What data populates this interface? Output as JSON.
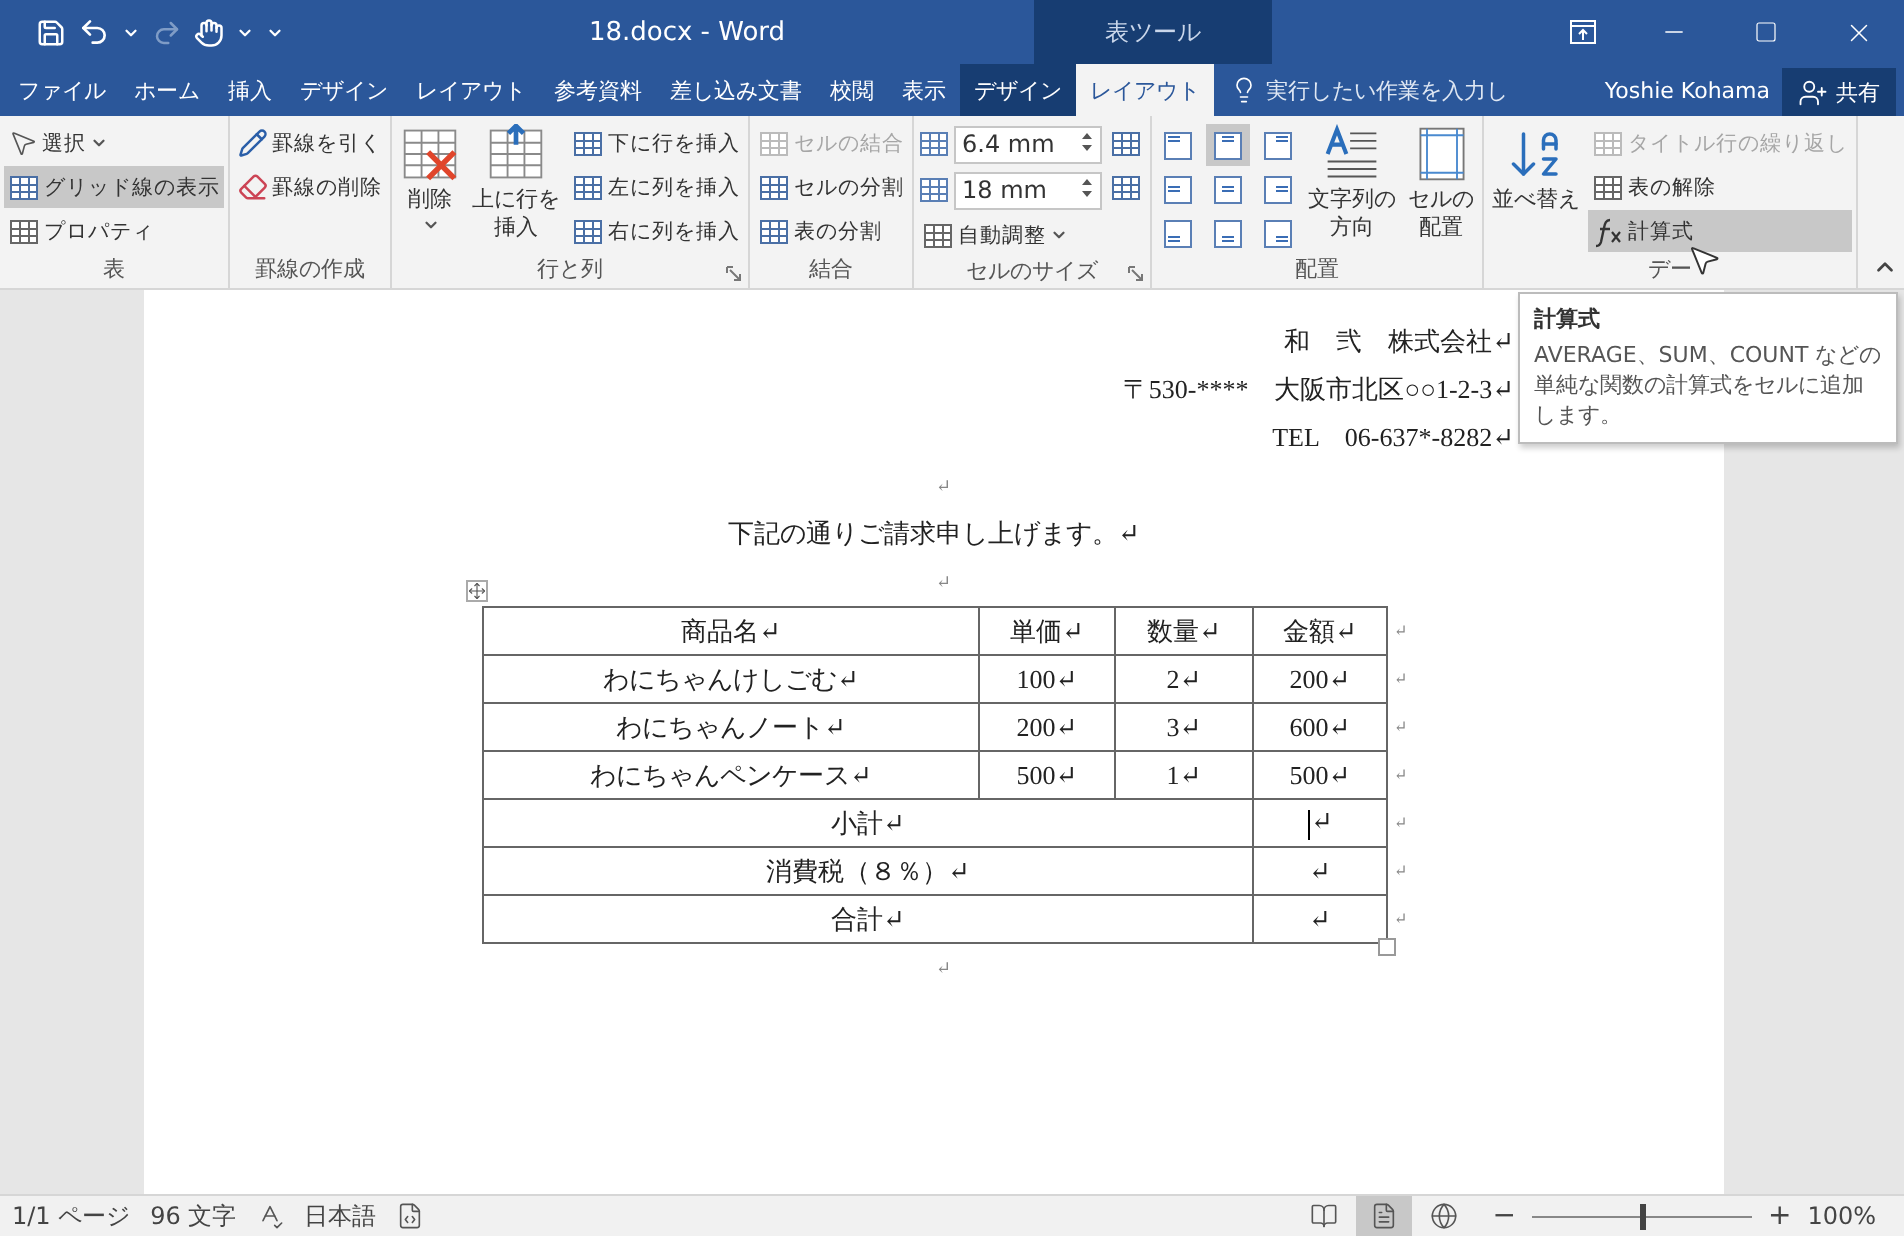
{
  "window": {
    "title": "18.docx - Word",
    "context_label": "表ツール"
  },
  "tabs": [
    {
      "label": "ファイル",
      "selected": false,
      "contextual": false
    },
    {
      "label": "ホーム",
      "selected": false,
      "contextual": false
    },
    {
      "label": "挿入",
      "selected": false,
      "contextual": false
    },
    {
      "label": "デザイン",
      "selected": false,
      "contextual": false
    },
    {
      "label": "レイアウト",
      "selected": false,
      "contextual": false
    },
    {
      "label": "参考資料",
      "selected": false,
      "contextual": false
    },
    {
      "label": "差し込み文書",
      "selected": false,
      "contextual": false
    },
    {
      "label": "校閲",
      "selected": false,
      "contextual": false
    },
    {
      "label": "表示",
      "selected": false,
      "contextual": false
    },
    {
      "label": "デザイン",
      "selected": false,
      "contextual": true
    },
    {
      "label": "レイアウト",
      "selected": true,
      "contextual": true
    }
  ],
  "tell_me": {
    "placeholder": "実行したい作業を入力し"
  },
  "user": "Yoshie Kohama",
  "share": "共有",
  "ribbon": {
    "groups": [
      {
        "label": "表",
        "launcher": false,
        "columns": [
          [
            {
              "kind": "small",
              "label": "選択",
              "dropdown": true,
              "selected": false,
              "disabled": false
            },
            {
              "kind": "small",
              "label": "グリッド線の表示",
              "selected": true,
              "disabled": false
            },
            {
              "kind": "small",
              "label": "プロパティ",
              "selected": false,
              "disabled": false
            }
          ]
        ]
      },
      {
        "label": "罫線の作成",
        "launcher": false,
        "columns": [
          [
            {
              "kind": "small",
              "label": "罫線を引く",
              "selected": false,
              "disabled": false
            },
            {
              "kind": "small",
              "label": "罫線の削除",
              "selected": false,
              "disabled": false
            }
          ]
        ]
      },
      {
        "label": "行と列",
        "launcher": true,
        "columns": [
          [
            {
              "kind": "large",
              "lines": [
                "削除"
              ],
              "dropdown": true,
              "selected": false,
              "disabled": false
            }
          ],
          [
            {
              "kind": "large",
              "lines": [
                "上に行を",
                "挿入"
              ],
              "selected": false,
              "disabled": false
            }
          ],
          [
            {
              "kind": "small",
              "label": "下に行を挿入",
              "selected": false,
              "disabled": false
            },
            {
              "kind": "small",
              "label": "左に列を挿入",
              "selected": false,
              "disabled": false
            },
            {
              "kind": "small",
              "label": "右に列を挿入",
              "selected": false,
              "disabled": false
            }
          ]
        ]
      },
      {
        "label": "結合",
        "launcher": false,
        "columns": [
          [
            {
              "kind": "small",
              "label": "セルの結合",
              "selected": false,
              "disabled": true
            },
            {
              "kind": "small",
              "label": "セルの分割",
              "selected": false,
              "disabled": false
            },
            {
              "kind": "small",
              "label": "表の分割",
              "selected": false,
              "disabled": false
            }
          ]
        ]
      },
      {
        "label": "セルのサイズ",
        "launcher": true,
        "columns": [
          [
            {
              "kind": "spin",
              "value": "6.4 mm"
            },
            {
              "kind": "spin",
              "value": "18 mm"
            },
            {
              "kind": "small",
              "label": "自動調整",
              "dropdown": true,
              "selected": false,
              "disabled": false
            }
          ],
          [
            {
              "kind": "icon",
              "selected": false
            },
            {
              "kind": "icon",
              "selected": false
            }
          ]
        ]
      },
      {
        "label": "配置",
        "launcher": false,
        "columns": [
          [
            {
              "kind": "align",
              "cells": [
                {
                  "selected": false
                },
                {
                  "selected": true
                },
                {
                  "selected": false
                },
                {
                  "selected": false
                },
                {
                  "selected": false
                },
                {
                  "selected": false
                },
                {
                  "selected": false
                },
                {
                  "selected": false
                },
                {
                  "selected": false
                }
              ]
            }
          ],
          [
            {
              "kind": "large",
              "lines": [
                "文字列の",
                "方向"
              ],
              "selected": false,
              "disabled": false
            }
          ],
          [
            {
              "kind": "large",
              "lines": [
                "セルの",
                "配置"
              ],
              "selected": false,
              "disabled": false
            }
          ]
        ]
      },
      {
        "label": "デー",
        "launcher": false,
        "columns": [
          [
            {
              "kind": "large",
              "lines": [
                "並べ替え"
              ],
              "selected": false,
              "disabled": false
            }
          ],
          [
            {
              "kind": "small",
              "label": "タイトル行の繰り返し",
              "selected": false,
              "disabled": true
            },
            {
              "kind": "small",
              "label": "表の解除",
              "selected": false,
              "disabled": false
            },
            {
              "kind": "small",
              "label": "計算式",
              "selected": true,
              "disabled": false
            }
          ]
        ]
      }
    ]
  },
  "document": {
    "header_lines": [
      "和　弐　株式会社↵",
      "〒530-****　大阪市北区○○1-2-3↵",
      "TEL　06-637*-8282↵"
    ],
    "blank_before": "↵",
    "greeting": "下記の通りご請求申し上げます。↵",
    "blank_mid": "↵",
    "table": {
      "columns": [
        "商品名↵",
        "単価↵",
        "数量↵",
        "金額↵"
      ],
      "header_end": "↵",
      "rows": [
        {
          "kind": "item",
          "cells": [
            "わにちゃんけしごむ↵",
            "100↵",
            "2↵",
            "200↵"
          ],
          "end": "↵"
        },
        {
          "kind": "item",
          "cells": [
            "わにちゃんノート↵",
            "200↵",
            "3↵",
            "600↵"
          ],
          "end": "↵"
        },
        {
          "kind": "item",
          "cells": [
            "わにちゃんペンケース↵",
            "500↵",
            "1↵",
            "500↵"
          ],
          "end": "↵"
        },
        {
          "kind": "summary",
          "label": "小計↵",
          "value": "↵",
          "caret": true,
          "end": "↵"
        },
        {
          "kind": "summary",
          "label": "消費税（８％）↵",
          "value": "↵",
          "caret": false,
          "end": "↵"
        },
        {
          "kind": "summary",
          "label": "合計↵",
          "value": "↵",
          "caret": false,
          "end": "↵"
        }
      ]
    },
    "blank_after": "↵"
  },
  "tooltip": {
    "title": "計算式",
    "body": "AVERAGE、SUM、COUNT などの単純な関数の計算式をセルに追加します。"
  },
  "status_bar": {
    "page": "1/1 ページ",
    "words": "96 文字",
    "language": "日本語",
    "views": [
      {
        "selected": false
      },
      {
        "selected": true
      },
      {
        "selected": false
      }
    ],
    "zoom": {
      "minus": "−",
      "plus": "+",
      "level": 0.5,
      "reading": "100%"
    }
  }
}
